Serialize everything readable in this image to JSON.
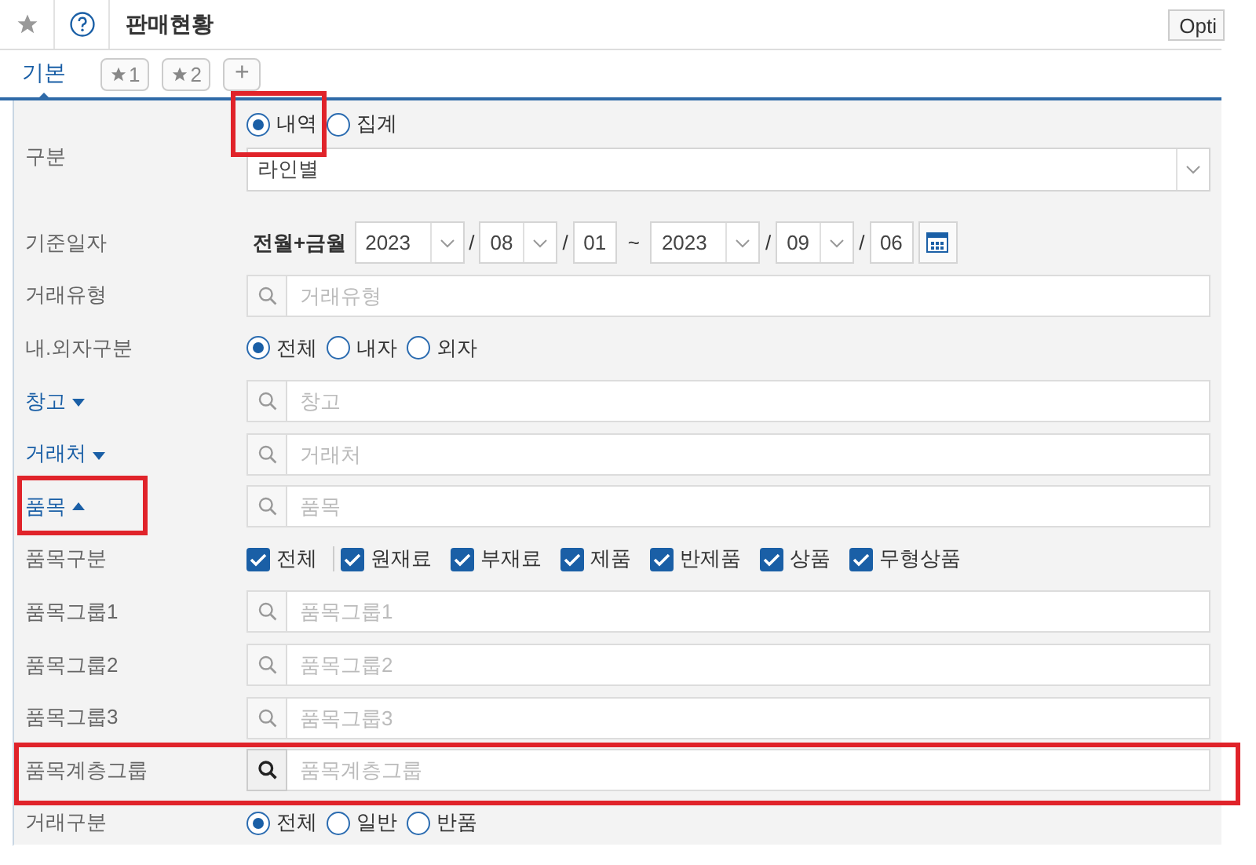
{
  "header": {
    "title": "판매현황",
    "option_button": "Opti"
  },
  "tabs": [
    {
      "kind": "text",
      "label": "기본",
      "selected": true
    },
    {
      "kind": "star",
      "label": "1",
      "selected": false
    },
    {
      "kind": "star",
      "label": "2",
      "selected": false
    },
    {
      "kind": "add",
      "label": "+",
      "selected": false
    }
  ],
  "rows": [
    {
      "kind": "division",
      "label": "구분",
      "options": [
        {
          "label": "내역",
          "selected": true,
          "highlighted": true
        },
        {
          "label": "집계",
          "selected": false
        }
      ],
      "value": "라인별"
    },
    {
      "kind": "date",
      "label": "기준일자",
      "period": "전월+금월",
      "date_separator": "/",
      "range_separator": "~",
      "from": {
        "year": "2023",
        "month": "08",
        "day": "01"
      },
      "to": {
        "year": "2023",
        "month": "09",
        "day": "06"
      }
    },
    {
      "kind": "search",
      "label": "거래유형",
      "placeholder": "거래유형"
    },
    {
      "kind": "radio",
      "label": "내.외자구분",
      "options": [
        {
          "label": "전체",
          "selected": true
        },
        {
          "label": "내자",
          "selected": false
        },
        {
          "label": "외자",
          "selected": false
        }
      ]
    },
    {
      "kind": "search",
      "label": "창고",
      "expanded": false,
      "placeholder": "창고"
    },
    {
      "kind": "search",
      "label": "거래처",
      "expanded": false,
      "placeholder": "거래처"
    },
    {
      "kind": "search",
      "label": "품목",
      "expanded": true,
      "label_highlighted": true,
      "placeholder": "품목"
    },
    {
      "kind": "checks",
      "label": "품목구분",
      "items": [
        {
          "label": "전체",
          "checked": true
        },
        {
          "label": "원재료",
          "checked": true
        },
        {
          "label": "부재료",
          "checked": true
        },
        {
          "label": "제품",
          "checked": true
        },
        {
          "label": "반제품",
          "checked": true
        },
        {
          "label": "상품",
          "checked": true
        },
        {
          "label": "무형상품",
          "checked": true
        }
      ]
    },
    {
      "kind": "search",
      "label": "품목그룹1",
      "placeholder": "품목그룹1"
    },
    {
      "kind": "search",
      "label": "품목그룹2",
      "placeholder": "품목그룹2"
    },
    {
      "kind": "search",
      "label": "품목그룹3",
      "placeholder": "품목그룹3"
    },
    {
      "kind": "search",
      "label": "품목계층그룹",
      "placeholder": "품목계층그룹",
      "highlighted": true,
      "search_active": true
    },
    {
      "kind": "radio",
      "label": "거래구분",
      "options": [
        {
          "label": "전체",
          "selected": true
        },
        {
          "label": "일반",
          "selected": false
        },
        {
          "label": "반품",
          "selected": false
        }
      ]
    }
  ]
}
